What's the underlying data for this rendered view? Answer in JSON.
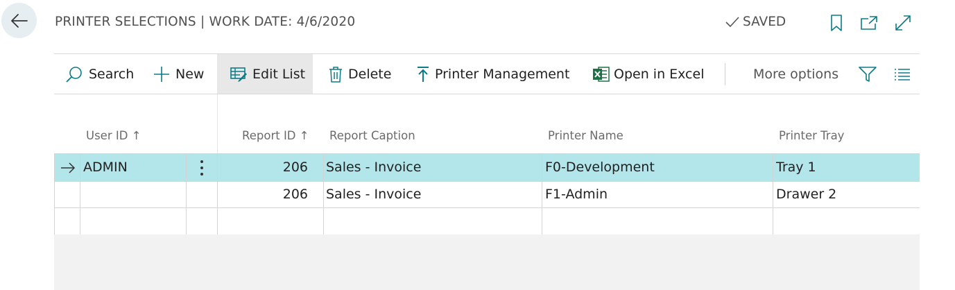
{
  "header": {
    "title": "PRINTER SELECTIONS | WORK DATE: 4/6/2020",
    "saved_label": "SAVED"
  },
  "actions": {
    "search": "Search",
    "new": "New",
    "edit_list": "Edit List",
    "delete": "Delete",
    "printer_management": "Printer Management",
    "open_in_excel": "Open in Excel",
    "more_options": "More options"
  },
  "columns": {
    "user_id": "User ID",
    "report_id": "Report ID",
    "report_caption": "Report Caption",
    "printer_name": "Printer Name",
    "printer_tray": "Printer Tray"
  },
  "rows": [
    {
      "user_id": "ADMIN",
      "report_id": "206",
      "report_caption": "Sales - Invoice",
      "printer_name": "F0-Development",
      "printer_tray": "Tray 1"
    },
    {
      "user_id": "",
      "report_id": "206",
      "report_caption": "Sales - Invoice",
      "printer_name": "F1-Admin",
      "printer_tray": "Drawer 2"
    },
    {
      "user_id": "",
      "report_id": "",
      "report_caption": "",
      "printer_name": "",
      "printer_tray": ""
    }
  ],
  "colors": {
    "selected_row": "#b3e6eb",
    "accent": "#0a7b87",
    "excel_green": "#1e7145"
  },
  "icons": [
    "back-arrow-icon",
    "checkmark-icon",
    "bookmark-icon",
    "open-new-window-icon",
    "expand-icon",
    "search-icon",
    "plus-icon",
    "edit-list-icon",
    "trash-icon",
    "upload-icon",
    "excel-icon",
    "filter-icon",
    "list-icon",
    "row-arrow-icon",
    "more-vertical-icon"
  ]
}
